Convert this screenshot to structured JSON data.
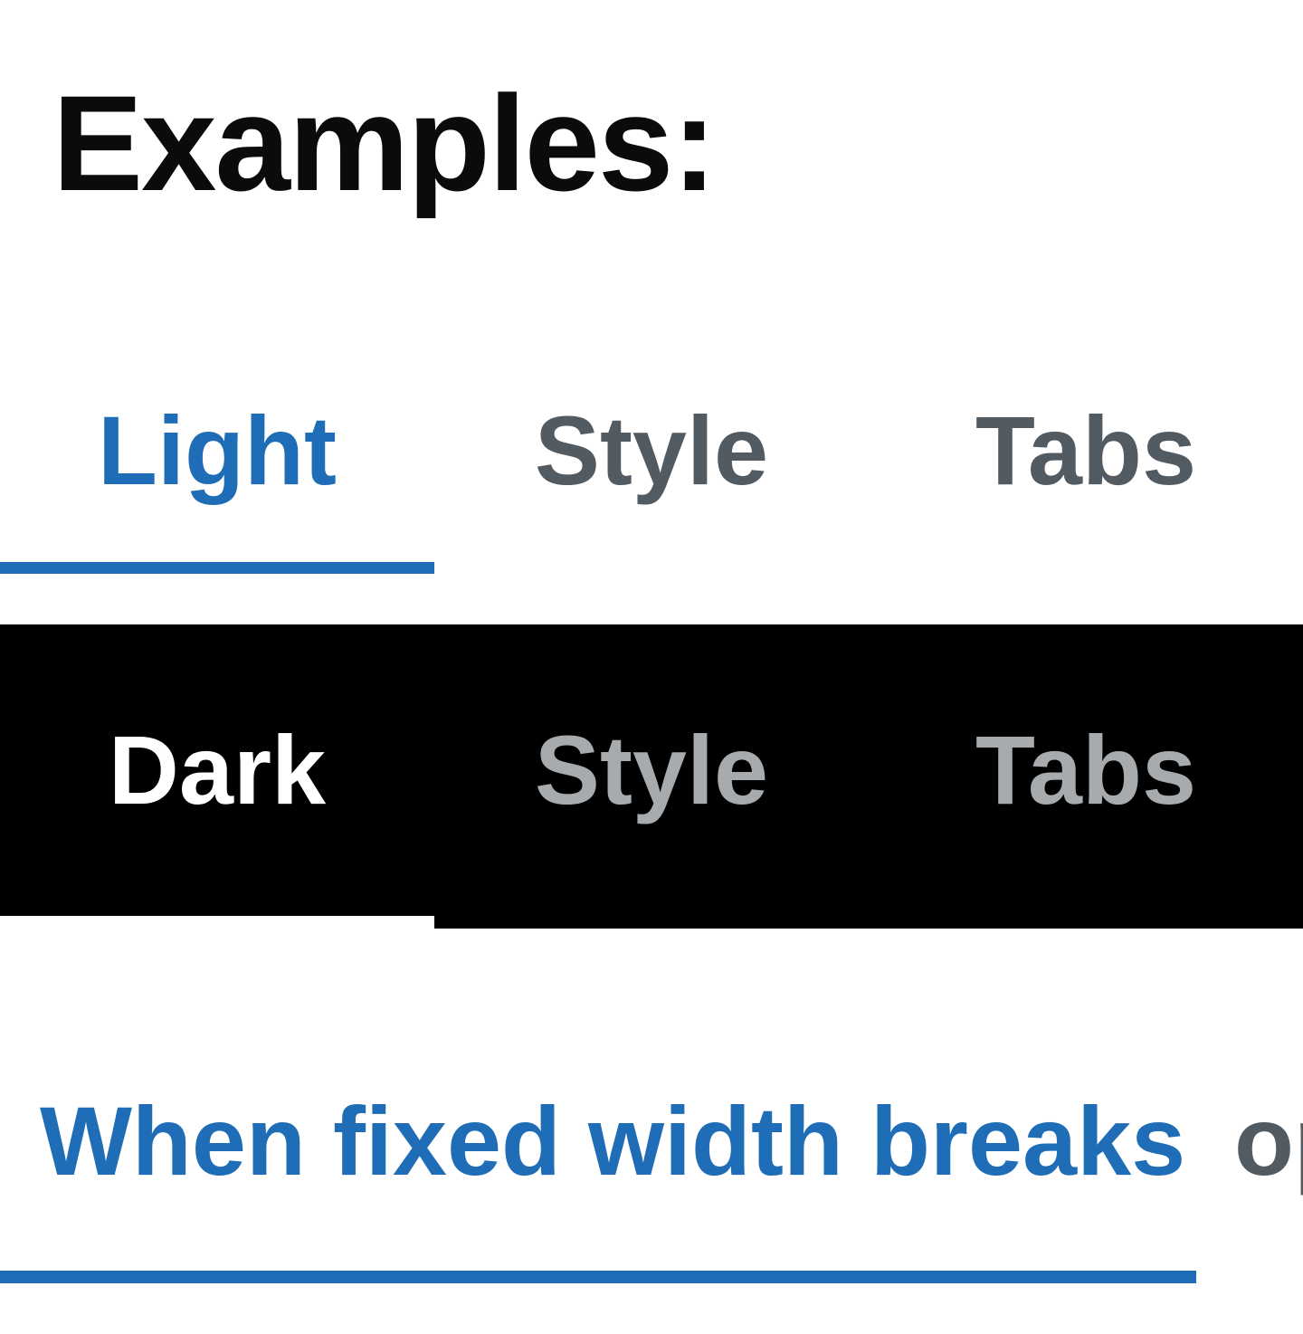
{
  "page": {
    "title": "Examples:"
  },
  "light_tabs": {
    "tabs": [
      {
        "label": "Light",
        "active": true
      },
      {
        "label": "Style",
        "active": false
      },
      {
        "label": "Tabs",
        "active": false
      }
    ],
    "colors": {
      "active_text": "#1f6db6",
      "inactive_text": "#525a62",
      "indicator": "#1f6db6",
      "background": "#ffffff"
    }
  },
  "dark_tabs": {
    "tabs": [
      {
        "label": "Dark",
        "active": true
      },
      {
        "label": "Style",
        "active": false
      },
      {
        "label": "Tabs",
        "active": false
      }
    ],
    "colors": {
      "active_text": "#ffffff",
      "inactive_text": "#a7abae",
      "indicator": "#ffffff",
      "background": "#000000"
    }
  },
  "overflow_tabs": {
    "tabs": [
      {
        "label": "When fixed width breaks",
        "active": true
      },
      {
        "label": "op",
        "active": false
      }
    ],
    "colors": {
      "active_text": "#1f6db6",
      "inactive_text": "#525a62",
      "indicator": "#1f6db6"
    }
  }
}
